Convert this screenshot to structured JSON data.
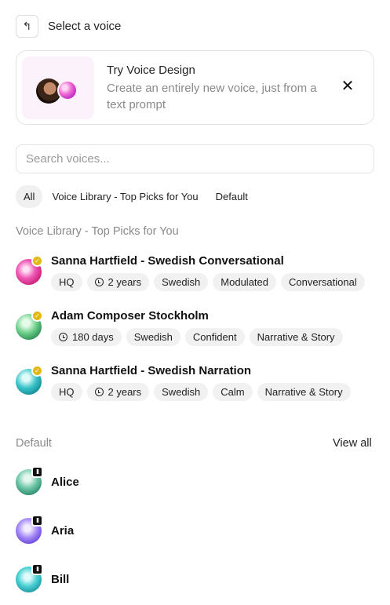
{
  "header": {
    "back_icon": "undo-arrow-icon",
    "title": "Select a voice"
  },
  "design_card": {
    "title": "Try Voice Design",
    "subtitle": "Create an entirely new voice, just from a text prompt",
    "close_icon": "close-icon",
    "close_glyph": "✕"
  },
  "search": {
    "placeholder": "Search voices...",
    "value": ""
  },
  "filters": [
    {
      "label": "All",
      "active": true
    },
    {
      "label": "Voice Library - Top Picks for You",
      "active": false
    },
    {
      "label": "Default",
      "active": false
    }
  ],
  "library": {
    "heading": "Voice Library - Top Picks for You",
    "voices": [
      {
        "name": "Sanna Hartfield - Swedish Conversational",
        "badge": "verified-check-icon",
        "tags": [
          "HQ",
          "2 years",
          "Swedish",
          "Modulated",
          "Conversational"
        ],
        "clock_tag_index": 1
      },
      {
        "name": "Adam Composer Stockholm",
        "badge": "verified-check-icon",
        "tags": [
          "180 days",
          "Swedish",
          "Confident",
          "Narrative & Story"
        ],
        "clock_tag_index": 0
      },
      {
        "name": "Sanna Hartfield - Swedish Narration",
        "badge": "verified-check-icon",
        "tags": [
          "HQ",
          "2 years",
          "Swedish",
          "Calm",
          "Narrative & Story"
        ],
        "clock_tag_index": 1
      }
    ]
  },
  "default": {
    "heading": "Default",
    "view_all": "View all",
    "voices": [
      {
        "name": "Alice",
        "badge": "pause-icon"
      },
      {
        "name": "Aria",
        "badge": "pause-icon"
      },
      {
        "name": "Bill",
        "badge": "pause-icon"
      }
    ]
  },
  "colors": {
    "accent_badge": "#e2b817",
    "tag_bg": "#f1f1f1",
    "muted_text": "#8a8a8a"
  }
}
